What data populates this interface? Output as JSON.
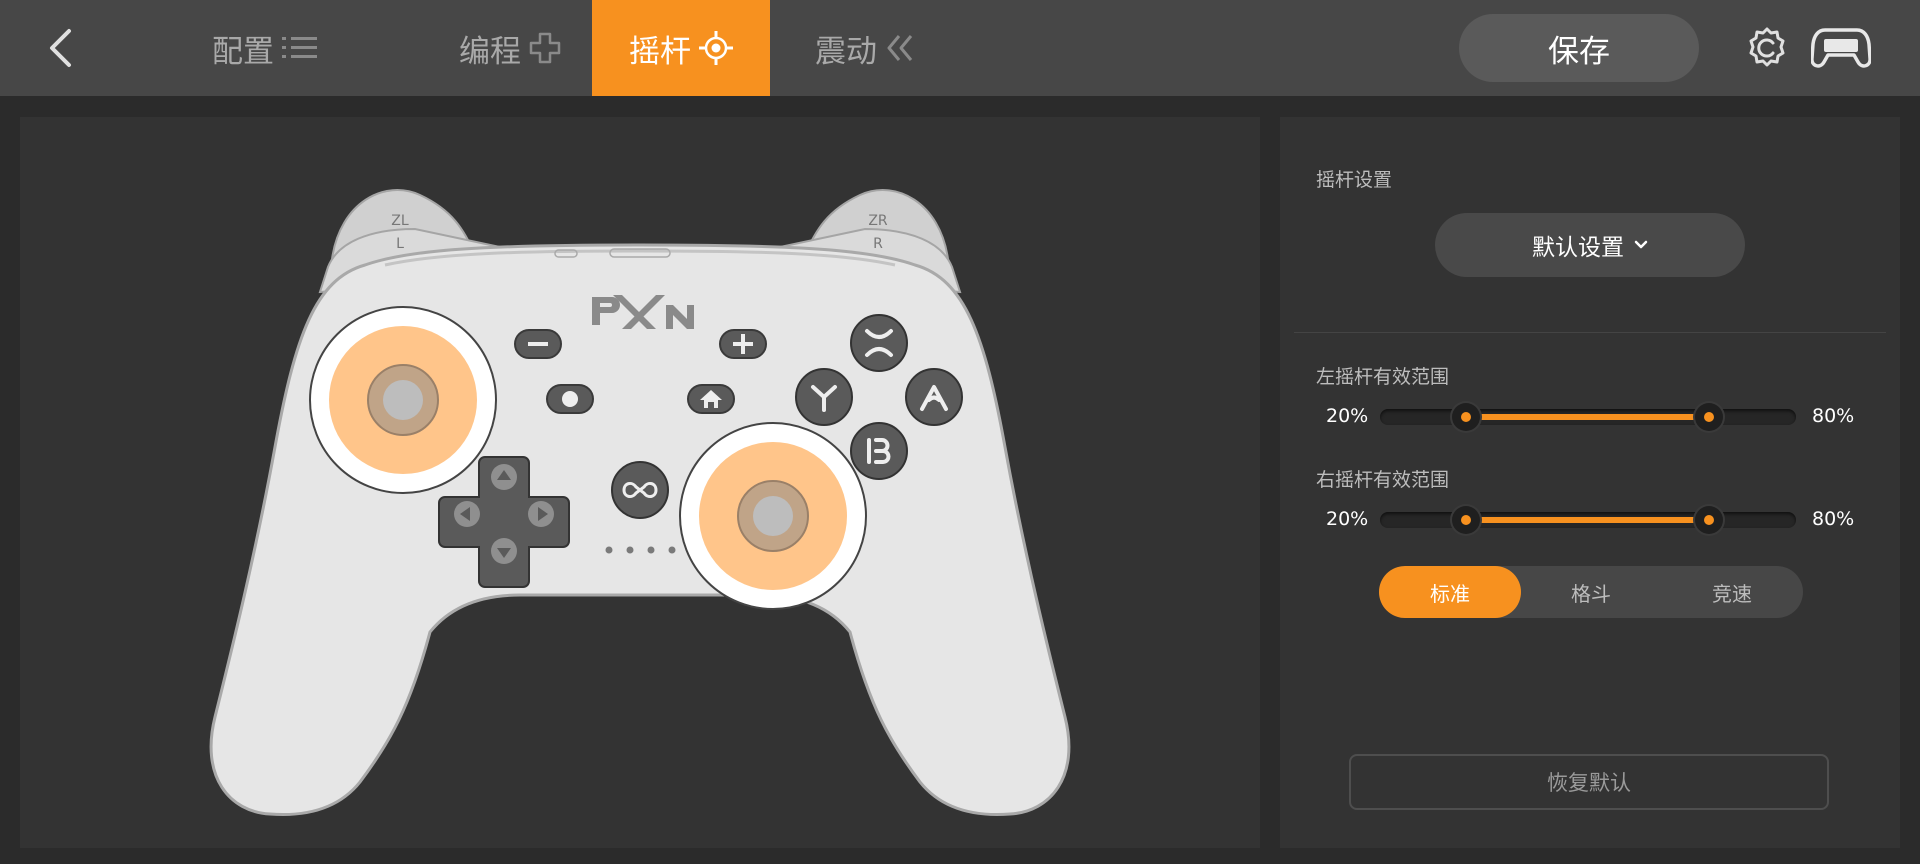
{
  "header": {
    "tabs": [
      {
        "label": "配置",
        "icon": "list-icon"
      },
      {
        "label": "编程",
        "icon": "cross-icon"
      },
      {
        "label": "摇杆",
        "icon": "joystick-target-icon"
      },
      {
        "label": "震动",
        "icon": "vibration-icon"
      }
    ],
    "active_tab": "摇杆",
    "save_label": "保存"
  },
  "controller": {
    "brand": "PXN",
    "shoulder": {
      "left_top": "ZL",
      "left_bottom": "L",
      "right_top": "ZR",
      "right_bottom": "R"
    },
    "face_buttons": [
      "X",
      "Y",
      "A",
      "B"
    ],
    "highlight_color": "#ffc58a"
  },
  "stick_settings": {
    "title": "摇杆设置",
    "preset": "默认设置",
    "left_range": {
      "label": "左摇杆有效范围",
      "min_label": "20%",
      "max_label": "80%",
      "min": 20,
      "max": 80
    },
    "right_range": {
      "label": "右摇杆有效范围",
      "min_label": "20%",
      "max_label": "80%",
      "min": 20,
      "max": 80
    },
    "modes": [
      "标准",
      "格斗",
      "竞速"
    ],
    "active_mode": "标准",
    "reset_label": "恢复默认"
  },
  "colors": {
    "accent": "#f7911f",
    "background": "#2b2b2b",
    "panel": "#333333"
  }
}
